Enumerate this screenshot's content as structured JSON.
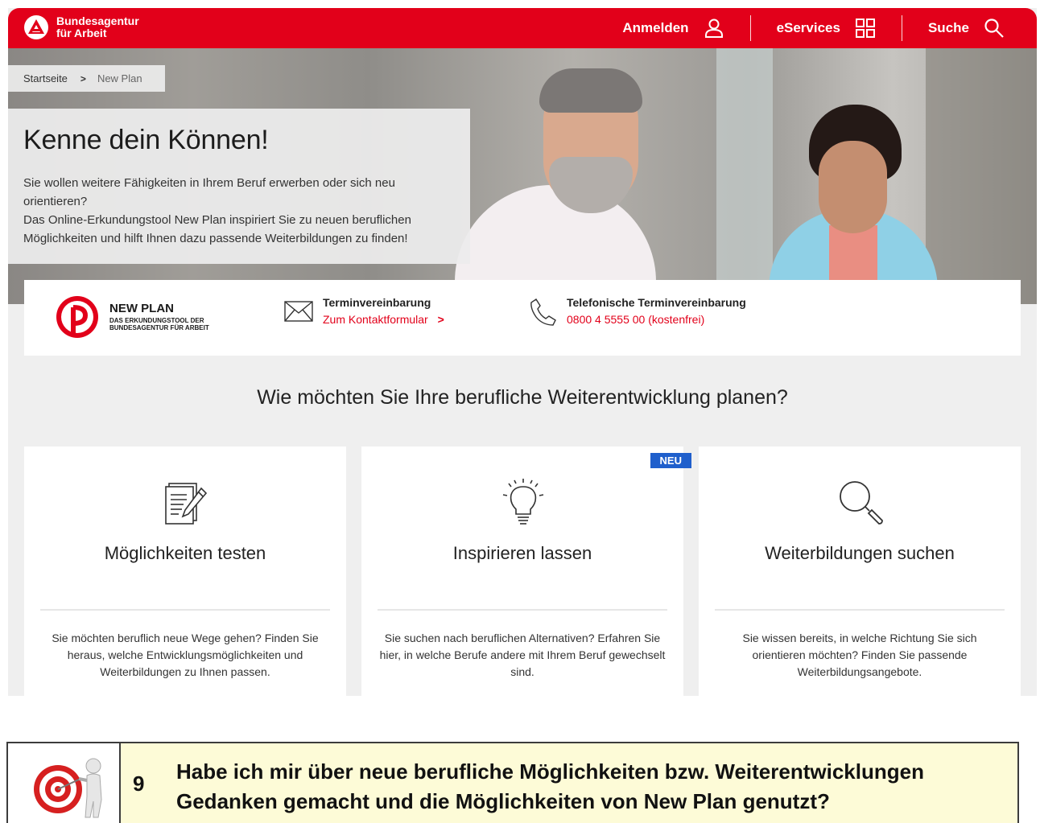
{
  "header": {
    "logo_line1": "Bundesagentur",
    "logo_line2": "für Arbeit",
    "nav": [
      {
        "label": "Anmelden"
      },
      {
        "label": "eServices"
      },
      {
        "label": "Suche"
      }
    ]
  },
  "breadcrumb": {
    "home": "Startseite",
    "current": "New Plan"
  },
  "intro": {
    "title": "Kenne dein Können!",
    "text1": "Sie wollen weitere Fähigkeiten in Ihrem Beruf erwerben oder sich neu orientieren?",
    "text2": "Das Online-Erkundungstool New Plan inspiriert Sie zu neuen beruflichen Möglichkeiten und hilft Ihnen dazu passende Weiterbildungen zu finden!"
  },
  "infobar": {
    "logo_title": "NEW PLAN",
    "logo_sub": "DAS ERKUNDUNGSTOOL DER BUNDESAGENTUR FÜR ARBEIT",
    "appointment_label": "Terminvereinbarung",
    "appointment_link": "Zum Kontaktformular",
    "phone_label": "Telefonische Terminvereinbarung",
    "phone_link": "0800 4 5555 00 (kostenfrei)"
  },
  "section": {
    "title": "Wie möchten Sie Ihre berufliche Weiterentwicklung planen?"
  },
  "cards": [
    {
      "title": "Möglichkeiten testen",
      "desc": "Sie möchten beruflich neue Wege gehen? Finden Sie heraus, welche Entwicklungsmöglichkeiten und Weiterbildungen zu Ihnen passen.",
      "icon": "document-pen-icon"
    },
    {
      "title": "Inspirieren lassen",
      "desc": "Sie suchen nach beruflichen Alternativen? Erfahren Sie hier, in welche Berufe andere mit Ihrem Beruf gewechselt sind.",
      "icon": "lightbulb-icon",
      "badge": "NEU"
    },
    {
      "title": "Weiterbildungen suchen",
      "desc": "Sie wissen bereits, in welche Richtung Sie sich orientieren möchten? Finden Sie passende Weiterbildungsangebote.",
      "icon": "magnifier-icon"
    }
  ],
  "checklist": {
    "number": "9",
    "question": "Habe ich mir über neue berufliche Möglichkeiten bzw. Weiterentwicklungen Gedanken gemacht und die Möglichkeiten von New Plan genutzt?"
  },
  "colors": {
    "brand_red": "#e2001a",
    "badge_blue": "#1f5fcc",
    "checklist_bg": "#fdfbd7"
  }
}
